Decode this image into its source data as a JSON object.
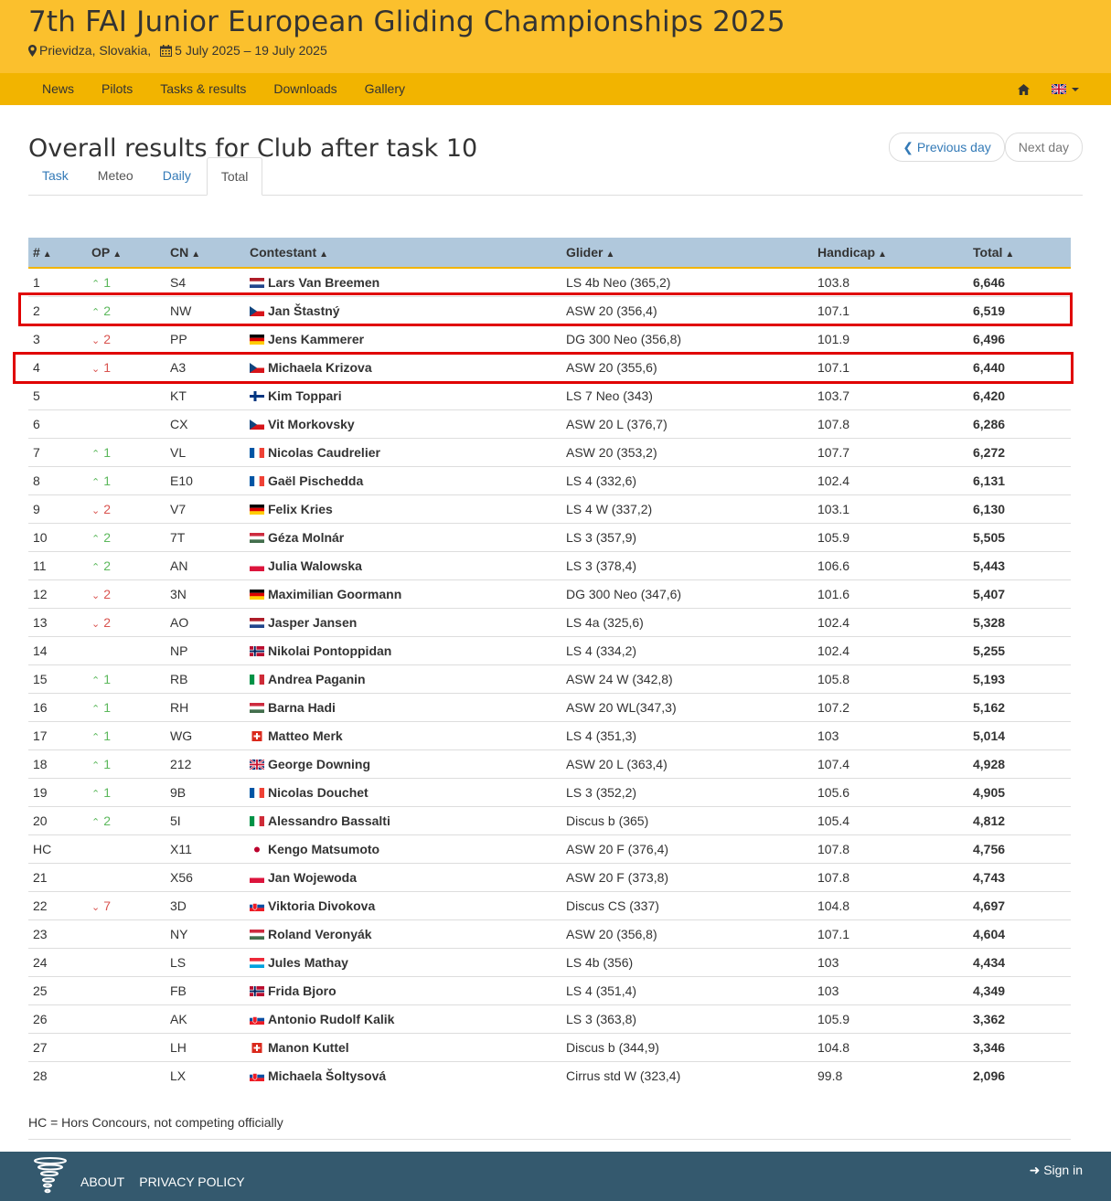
{
  "site": {
    "title": "7th FAI Junior European Gliding Championships 2025",
    "location": "Prievidza, Slovakia,",
    "dates": "5 July 2025 – 19 July 2025"
  },
  "nav": {
    "items": [
      "News",
      "Pilots",
      "Tasks & results",
      "Downloads",
      "Gallery"
    ]
  },
  "page": {
    "title": "Overall results for Club after task 10",
    "prev_label": "Previous day",
    "next_label": "Next day"
  },
  "tabs": [
    "Task",
    "Meteo",
    "Daily",
    "Total"
  ],
  "table": {
    "headers": [
      "#",
      "OP",
      "CN",
      "Contestant",
      "Glider",
      "Handicap",
      "Total"
    ],
    "rows": [
      {
        "rank": "1",
        "dir": "up",
        "op": "1",
        "cn": "S4",
        "flag": "nl",
        "name": "Lars Van Breemen",
        "glider": "LS 4b Neo (365,2)",
        "handicap": "103.8",
        "total": "6,646"
      },
      {
        "rank": "2",
        "dir": "up",
        "op": "2",
        "cn": "NW",
        "flag": "cz",
        "name": "Jan Štastný",
        "glider": "ASW 20 (356,4)",
        "handicap": "107.1",
        "total": "6,519"
      },
      {
        "rank": "3",
        "dir": "down",
        "op": "2",
        "cn": "PP",
        "flag": "de",
        "name": "Jens Kammerer",
        "glider": "DG 300 Neo (356,8)",
        "handicap": "101.9",
        "total": "6,496"
      },
      {
        "rank": "4",
        "dir": "down",
        "op": "1",
        "cn": "A3",
        "flag": "cz",
        "name": "Michaela Krizova",
        "glider": "ASW 20 (355,6)",
        "handicap": "107.1",
        "total": "6,440"
      },
      {
        "rank": "5",
        "dir": "",
        "op": "",
        "cn": "KT",
        "flag": "fi",
        "name": "Kim Toppari",
        "glider": "LS 7 Neo (343)",
        "handicap": "103.7",
        "total": "6,420"
      },
      {
        "rank": "6",
        "dir": "",
        "op": "",
        "cn": "CX",
        "flag": "cz",
        "name": "Vit Morkovsky",
        "glider": "ASW 20 L (376,7)",
        "handicap": "107.8",
        "total": "6,286"
      },
      {
        "rank": "7",
        "dir": "up",
        "op": "1",
        "cn": "VL",
        "flag": "fr",
        "name": "Nicolas Caudrelier",
        "glider": "ASW 20 (353,2)",
        "handicap": "107.7",
        "total": "6,272"
      },
      {
        "rank": "8",
        "dir": "up",
        "op": "1",
        "cn": "E10",
        "flag": "fr",
        "name": "Gaël Pischedda",
        "glider": "LS 4 (332,6)",
        "handicap": "102.4",
        "total": "6,131"
      },
      {
        "rank": "9",
        "dir": "down",
        "op": "2",
        "cn": "V7",
        "flag": "de",
        "name": "Felix Kries",
        "glider": "LS 4 W (337,2)",
        "handicap": "103.1",
        "total": "6,130"
      },
      {
        "rank": "10",
        "dir": "up",
        "op": "2",
        "cn": "7T",
        "flag": "hu",
        "name": "Géza Molnár",
        "glider": "LS 3 (357,9)",
        "handicap": "105.9",
        "total": "5,505"
      },
      {
        "rank": "11",
        "dir": "up",
        "op": "2",
        "cn": "AN",
        "flag": "pl",
        "name": "Julia Walowska",
        "glider": "LS 3 (378,4)",
        "handicap": "106.6",
        "total": "5,443"
      },
      {
        "rank": "12",
        "dir": "down",
        "op": "2",
        "cn": "3N",
        "flag": "de",
        "name": "Maximilian Goormann",
        "glider": "DG 300 Neo (347,6)",
        "handicap": "101.6",
        "total": "5,407"
      },
      {
        "rank": "13",
        "dir": "down",
        "op": "2",
        "cn": "AO",
        "flag": "nl",
        "name": "Jasper Jansen",
        "glider": "LS 4a (325,6)",
        "handicap": "102.4",
        "total": "5,328"
      },
      {
        "rank": "14",
        "dir": "",
        "op": "",
        "cn": "NP",
        "flag": "no",
        "name": "Nikolai Pontoppidan",
        "glider": "LS 4 (334,2)",
        "handicap": "102.4",
        "total": "5,255"
      },
      {
        "rank": "15",
        "dir": "up",
        "op": "1",
        "cn": "RB",
        "flag": "it",
        "name": "Andrea Paganin",
        "glider": "ASW 24 W (342,8)",
        "handicap": "105.8",
        "total": "5,193"
      },
      {
        "rank": "16",
        "dir": "up",
        "op": "1",
        "cn": "RH",
        "flag": "hu",
        "name": "Barna Hadi",
        "glider": "ASW 20 WL(347,3)",
        "handicap": "107.2",
        "total": "5,162"
      },
      {
        "rank": "17",
        "dir": "up",
        "op": "1",
        "cn": "WG",
        "flag": "ch",
        "name": "Matteo Merk",
        "glider": "LS 4 (351,3)",
        "handicap": "103",
        "total": "5,014"
      },
      {
        "rank": "18",
        "dir": "up",
        "op": "1",
        "cn": "212",
        "flag": "gb",
        "name": "George Downing",
        "glider": "ASW 20 L (363,4)",
        "handicap": "107.4",
        "total": "4,928"
      },
      {
        "rank": "19",
        "dir": "up",
        "op": "1",
        "cn": "9B",
        "flag": "fr",
        "name": "Nicolas Douchet",
        "glider": "LS 3 (352,2)",
        "handicap": "105.6",
        "total": "4,905"
      },
      {
        "rank": "20",
        "dir": "up",
        "op": "2",
        "cn": "5I",
        "flag": "it",
        "name": "Alessandro Bassalti",
        "glider": "Discus b (365)",
        "handicap": "105.4",
        "total": "4,812"
      },
      {
        "rank": "HC",
        "dir": "",
        "op": "",
        "cn": "X11",
        "flag": "jp",
        "name": "Kengo Matsumoto",
        "glider": "ASW 20 F (376,4)",
        "handicap": "107.8",
        "total": "4,756"
      },
      {
        "rank": "21",
        "dir": "",
        "op": "",
        "cn": "X56",
        "flag": "pl",
        "name": "Jan Wojewoda",
        "glider": "ASW 20 F (373,8)",
        "handicap": "107.8",
        "total": "4,743"
      },
      {
        "rank": "22",
        "dir": "down",
        "op": "7",
        "cn": "3D",
        "flag": "sk",
        "name": "Viktoria Divokova",
        "glider": "Discus CS (337)",
        "handicap": "104.8",
        "total": "4,697"
      },
      {
        "rank": "23",
        "dir": "",
        "op": "",
        "cn": "NY",
        "flag": "hu",
        "name": "Roland Veronyák",
        "glider": "ASW 20 (356,8)",
        "handicap": "107.1",
        "total": "4,604"
      },
      {
        "rank": "24",
        "dir": "",
        "op": "",
        "cn": "LS",
        "flag": "lu",
        "name": "Jules Mathay",
        "glider": "LS 4b (356)",
        "handicap": "103",
        "total": "4,434"
      },
      {
        "rank": "25",
        "dir": "",
        "op": "",
        "cn": "FB",
        "flag": "no",
        "name": "Frida Bjoro",
        "glider": "LS 4 (351,4)",
        "handicap": "103",
        "total": "4,349"
      },
      {
        "rank": "26",
        "dir": "",
        "op": "",
        "cn": "AK",
        "flag": "sk",
        "name": "Antonio Rudolf Kalik",
        "glider": "LS 3 (363,8)",
        "handicap": "105.9",
        "total": "3,362"
      },
      {
        "rank": "27",
        "dir": "",
        "op": "",
        "cn": "LH",
        "flag": "ch",
        "name": "Manon Kuttel",
        "glider": "Discus b (344,9)",
        "handicap": "104.8",
        "total": "3,346"
      },
      {
        "rank": "28",
        "dir": "",
        "op": "",
        "cn": "LX",
        "flag": "sk",
        "name": "Michaela Šoltysová",
        "glider": "Cirrus std W (323,4)",
        "handicap": "99.8",
        "total": "2,096"
      }
    ]
  },
  "footnote": "HC = Hors Concours, not competing officially",
  "footer": {
    "about": "ABOUT",
    "privacy": "PRIVACY POLICY",
    "signin": "Sign in"
  },
  "colors": {
    "header": "#fbc02d",
    "navbar": "#f2b400",
    "table_head": "#b0c8dc",
    "footer": "#34596e",
    "up": "#5cb85c",
    "down": "#d9534f",
    "highlight": "#e00000"
  }
}
